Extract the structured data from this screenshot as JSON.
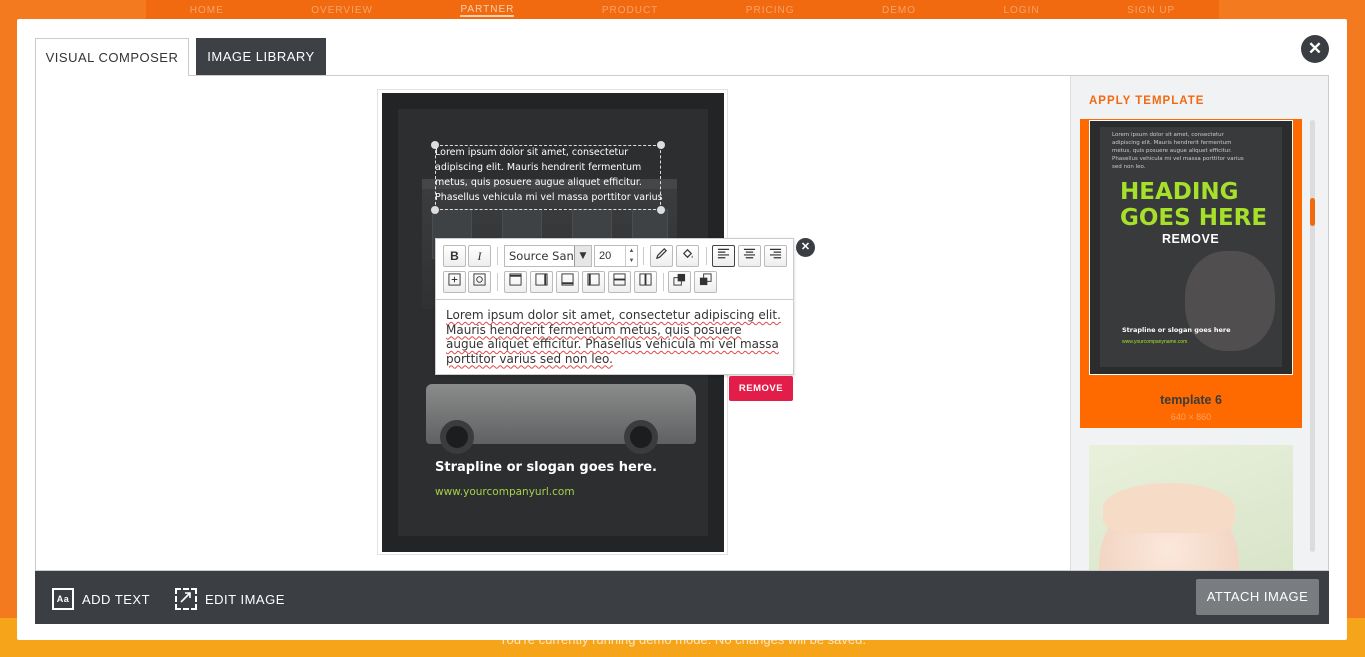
{
  "background": {
    "nav_items": [
      "HOME",
      "OVERVIEW",
      "PARTNER",
      "PRODUCT",
      "PRICING",
      "DEMO",
      "LOGIN",
      "SIGN UP"
    ],
    "footer_text": "You're currently running demo mode. No changes will be saved."
  },
  "tabs": {
    "visual_composer": "VISUAL COMPOSER",
    "image_library": "IMAGE LIBRARY"
  },
  "canvas": {
    "text_block": "Lorem ipsum dolor sit amet, consectetur adipiscing elit. Mauris hendrerit fermentum metus, quis posuere augue aliquet efficitur. Phasellus vehicula mi vel massa porttitor varius",
    "strapline": "Strapline or slogan goes here.",
    "company_url": "www.yourcompanyurl.com"
  },
  "editor": {
    "bold": "B",
    "italic": "I",
    "font_family": "Source Sans",
    "font_size": "20",
    "text": "Lorem ipsum dolor sit amet, consectetur adipiscing elit. Mauris hendrerit fermentum metus, quis posuere augue aliquet efficitur. Phasellus vehicula mi vel massa porttitor varius sed non leo.",
    "remove_label": "REMOVE"
  },
  "panel": {
    "title": "APPLY TEMPLATE",
    "template": {
      "small_text": "Lorem ipsum dolor sit amet, consectetur adipiscing elit. Mauris hendrerit fermentum metus, quis posuere augue aliquet efficitur. Phasellus vehicula mi vel massa porttitor varius sed non leo.",
      "heading": "HEADING GOES HERE",
      "remove": "REMOVE",
      "strapline": "Strapline or slogan goes here",
      "url": "www.yourcompanyname.com",
      "name": "template 6",
      "size": "640 × 860"
    },
    "accent_color": "#fe6a00"
  },
  "bottom_bar": {
    "add_text": "ADD TEXT",
    "add_text_icon": "Aa",
    "edit_image": "EDIT IMAGE",
    "attach_image": "ATTACH IMAGE"
  },
  "colors": {
    "brand_orange": "#f47a20",
    "dark_bar": "#3b3e42",
    "remove_red": "#e31d4a",
    "link_green": "#a6d04d"
  }
}
